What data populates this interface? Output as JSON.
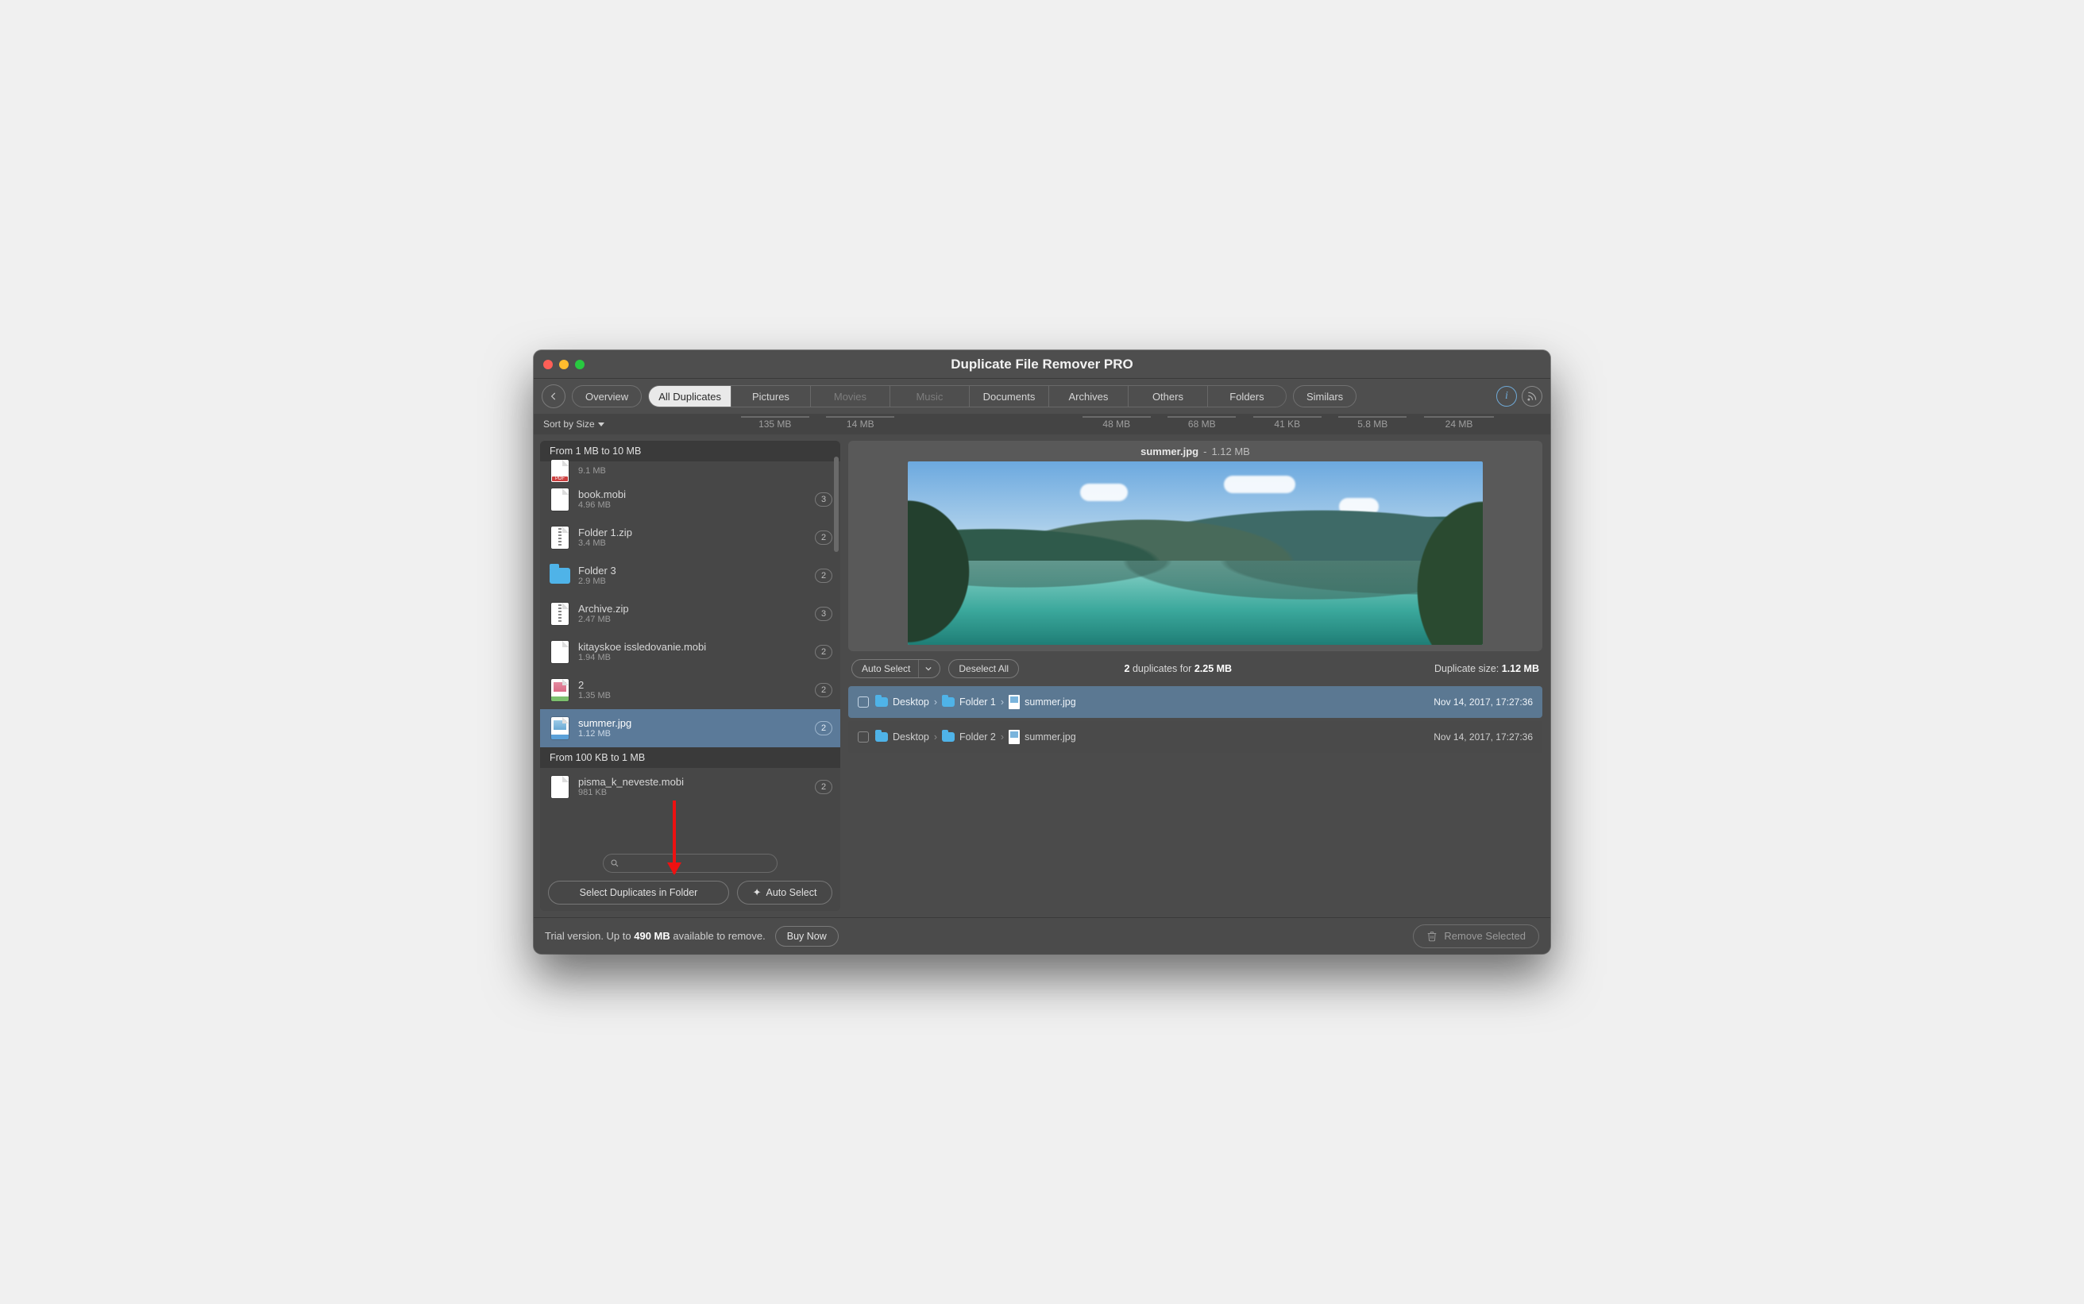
{
  "window": {
    "title": "Duplicate File Remover PRO"
  },
  "toolbar": {
    "overview": "Overview",
    "similars": "Similars",
    "tabs": [
      {
        "label": "All Duplicates",
        "size": "135 MB",
        "active": true
      },
      {
        "label": "Pictures",
        "size": "14 MB"
      },
      {
        "label": "Movies",
        "size": "",
        "dim": true
      },
      {
        "label": "Music",
        "size": "",
        "dim": true
      },
      {
        "label": "Documents",
        "size": "48 MB"
      },
      {
        "label": "Archives",
        "size": "68 MB"
      },
      {
        "label": "Others",
        "size": "41 KB"
      },
      {
        "label": "Folders",
        "size": "5.8 MB"
      }
    ],
    "similars_size": "24 MB"
  },
  "sort_label": "Sort by Size",
  "groups": [
    {
      "header": "From 1 MB to 10 MB",
      "items": [
        {
          "name": "",
          "size": "9.1 MB",
          "kind": "pdf",
          "count": "",
          "small": true
        },
        {
          "name": "book.mobi",
          "size": "4.96 MB",
          "kind": "file",
          "count": "3"
        },
        {
          "name": "Folder 1.zip",
          "size": "3.4 MB",
          "kind": "zip",
          "count": "2"
        },
        {
          "name": "Folder 3",
          "size": "2.9 MB",
          "kind": "folder",
          "count": "2"
        },
        {
          "name": "Archive.zip",
          "size": "2.47 MB",
          "kind": "zip",
          "count": "3"
        },
        {
          "name": "kitayskoe issledovanie.mobi",
          "size": "1.94 MB",
          "kind": "file",
          "count": "2"
        },
        {
          "name": "2",
          "size": "1.35 MB",
          "kind": "png",
          "count": "2"
        },
        {
          "name": "summer.jpg",
          "size": "1.12 MB",
          "kind": "jpg",
          "count": "2",
          "selected": true
        }
      ]
    },
    {
      "header": "From 100 KB to 1 MB",
      "items": [
        {
          "name": "pisma_k_neveste.mobi",
          "size": "981 KB",
          "kind": "file",
          "count": "2"
        }
      ]
    }
  ],
  "left_buttons": {
    "select_in_folder": "Select Duplicates in Folder",
    "auto_select": "Auto Select"
  },
  "preview": {
    "name": "summer.jpg",
    "size": "1.12 MB"
  },
  "dupbar": {
    "auto_select": "Auto Select",
    "deselect_all": "Deselect All",
    "count_text_a": "2",
    "count_text_b": "duplicates for",
    "count_text_c": "2.25 MB",
    "dupsize_label": "Duplicate size:",
    "dupsize_value": "1.12 MB"
  },
  "duplicates": [
    {
      "path": [
        "Desktop",
        "Folder 1",
        "summer.jpg"
      ],
      "ts": "Nov 14, 2017, 17:27:36",
      "selected": true
    },
    {
      "path": [
        "Desktop",
        "Folder 2",
        "summer.jpg"
      ],
      "ts": "Nov 14, 2017, 17:27:36"
    }
  ],
  "bottom": {
    "trial_a": "Trial version. Up to",
    "trial_b": "490 MB",
    "trial_c": "available to remove.",
    "buy": "Buy Now",
    "remove": "Remove Selected"
  }
}
